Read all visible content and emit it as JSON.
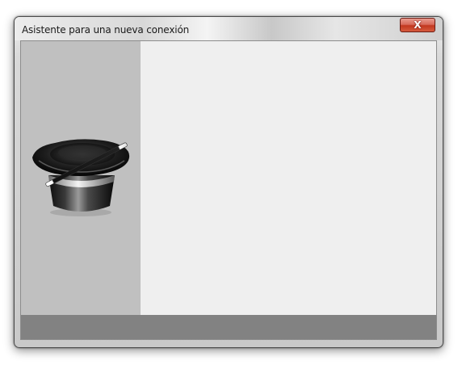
{
  "window": {
    "title": "Asistente para una nueva conexión",
    "close_glyph": "X"
  },
  "sidebar": {
    "image_icon": "magic-hat-wand-icon"
  },
  "colors": {
    "sidebar_bg": "#c0c0c0",
    "content_bg": "#efefef",
    "footer_bg": "#828282",
    "close_button": "#c8402a"
  }
}
